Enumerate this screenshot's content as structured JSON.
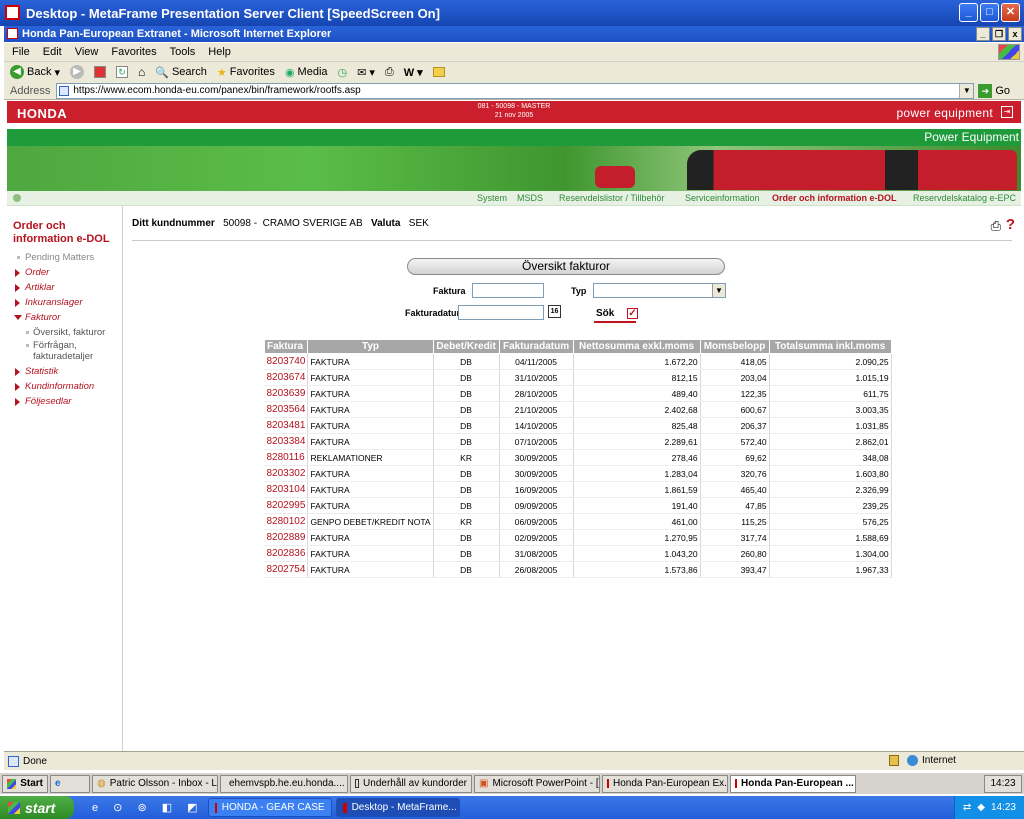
{
  "outer_window": {
    "title": "Desktop - MetaFrame Presentation Server Client [SpeedScreen On]"
  },
  "ie_window": {
    "title": "Honda Pan-European Extranet - Microsoft Internet Explorer"
  },
  "menu": [
    "File",
    "Edit",
    "View",
    "Favorites",
    "Tools",
    "Help"
  ],
  "toolbar": {
    "back": "Back",
    "search": "Search",
    "favorites": "Favorites",
    "media": "Media"
  },
  "address": {
    "label": "Address",
    "url": "https://www.ecom.honda-eu.com/panex/bin/framework/rootfs.asp",
    "go": "Go"
  },
  "header": {
    "logo": "HONDA",
    "dealer": "081 - 50098 - MASTER",
    "date": "21 nov 2005",
    "division": "power equipment",
    "banner_title": "Power Equipment"
  },
  "nav": [
    {
      "label": "System"
    },
    {
      "label": "MSDS"
    },
    {
      "label": "Reservdelslistor / Tillbehör"
    },
    {
      "label": "Serviceinformation"
    },
    {
      "label": "Order och information e-DOL",
      "active": true
    },
    {
      "label": "Reservdelskatalog e-EPC"
    }
  ],
  "sidebar": {
    "title_line1": "Order och",
    "title_line2": "information e-DOL",
    "items": [
      "Pending Matters",
      "Order",
      "Artiklar",
      "Inkuranslager",
      "Fakturor",
      "Översikt, fakturor",
      "Förfrågan,",
      "fakturadetaljer",
      "Statistik",
      "Kundinformation",
      "Följesedlar"
    ]
  },
  "customer": {
    "label": "Ditt kundnummer",
    "number": "50098 -",
    "name": "CRAMO SVERIGE AB",
    "currency_label": "Valuta",
    "currency": "SEK"
  },
  "form": {
    "title": "Översikt fakturor",
    "faktura_label": "Faktura",
    "faktura_value": "",
    "typ_label": "Typ",
    "typ_value": "",
    "datum_label": "Fakturadatum",
    "datum_value": "",
    "calendar": "16",
    "sok_label": "Sök"
  },
  "table": {
    "headers": [
      "Faktura",
      "Typ",
      "Debet/Kredit",
      "Fakturadatum",
      "Nettosumma exkl.moms",
      "Momsbelopp",
      "Totalsumma inkl.moms"
    ],
    "rows": [
      [
        "8203740",
        "FAKTURA",
        "DB",
        "04/11/2005",
        "1.672,20",
        "418,05",
        "2.090,25"
      ],
      [
        "8203674",
        "FAKTURA",
        "DB",
        "31/10/2005",
        "812,15",
        "203,04",
        "1.015,19"
      ],
      [
        "8203639",
        "FAKTURA",
        "DB",
        "28/10/2005",
        "489,40",
        "122,35",
        "611,75"
      ],
      [
        "8203564",
        "FAKTURA",
        "DB",
        "21/10/2005",
        "2.402,68",
        "600,67",
        "3.003,35"
      ],
      [
        "8203481",
        "FAKTURA",
        "DB",
        "14/10/2005",
        "825,48",
        "206,37",
        "1.031,85"
      ],
      [
        "8203384",
        "FAKTURA",
        "DB",
        "07/10/2005",
        "2.289,61",
        "572,40",
        "2.862,01"
      ],
      [
        "8280116",
        "REKLAMATIONER",
        "KR",
        "30/09/2005",
        "278,46",
        "69,62",
        "348,08"
      ],
      [
        "8203302",
        "FAKTURA",
        "DB",
        "30/09/2005",
        "1.283,04",
        "320,76",
        "1.603,80"
      ],
      [
        "8203104",
        "FAKTURA",
        "DB",
        "16/09/2005",
        "1.861,59",
        "465,40",
        "2.326,99"
      ],
      [
        "8202995",
        "FAKTURA",
        "DB",
        "09/09/2005",
        "191,40",
        "47,85",
        "239,25"
      ],
      [
        "8280102",
        "GENPO DEBET/KREDIT NOTA",
        "KR",
        "06/09/2005",
        "461,00",
        "115,25",
        "576,25"
      ],
      [
        "8202889",
        "FAKTURA",
        "DB",
        "02/09/2005",
        "1.270,95",
        "317,74",
        "1.588,69"
      ],
      [
        "8202836",
        "FAKTURA",
        "DB",
        "31/08/2005",
        "1.043,20",
        "260,80",
        "1.304,00"
      ],
      [
        "8202754",
        "FAKTURA",
        "DB",
        "26/08/2005",
        "1.573,86",
        "393,47",
        "1.967,33"
      ]
    ]
  },
  "status": {
    "text": "Done",
    "zone": "Internet"
  },
  "taskbar1": {
    "start": "Start",
    "items": [
      "Patric Olsson - Inbox - L...",
      "ehemvspb.he.eu.honda....",
      "Underhåll av kundorder",
      "Microsoft PowerPoint - [...",
      "Honda Pan-European Ex...",
      "Honda Pan-European ..."
    ],
    "clock": "14:23"
  },
  "taskbar2": {
    "start": "start",
    "items": [
      "HONDA - GEAR CASE",
      "Desktop - MetaFrame..."
    ],
    "clock": "14:23"
  }
}
